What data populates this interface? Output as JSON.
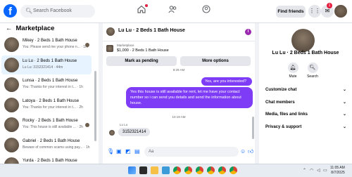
{
  "topbar": {
    "logo": "f",
    "search_placeholder": "Search Facebook",
    "find_friends": "Find friends",
    "notification_count": "1",
    "nav_icons": [
      "home-icon",
      "friends-icon",
      "groups-icon"
    ]
  },
  "sidebar": {
    "title": "Marketplace",
    "back": "←",
    "conversations": [
      {
        "name": "Mikey · 2 Beds 1 Bath House",
        "preview": "You: Please send me your phone n... · 1m",
        "active": false
      },
      {
        "name": "Lu Lu · 2 Beds 1 Bath House",
        "preview": "Lu Lu: 3152321414 · 44m",
        "active": true
      },
      {
        "name": "Lunsa · 2 Beds 1 Bath House",
        "preview": "You: Thanks for your interest in t... · 1h",
        "active": false
      },
      {
        "name": "Latoya · 2 Beds 1 Bath House",
        "preview": "You: Thanks for your interest in t... · 2h",
        "active": false
      },
      {
        "name": "Rocky · 2 Beds 1 Bath House",
        "preview": "You: This house is still available ... · 2h",
        "active": false
      },
      {
        "name": "Gabriel · 2 Beds 1 Bath House",
        "preview": "Beware of common scams using pay... · 1h",
        "active": false
      },
      {
        "name": "Yurda · 2 Beds 1 Bath House",
        "preview": "You: Please can you hear contact num... · 1h",
        "active": false
      }
    ]
  },
  "chat": {
    "title": "Lu Lu · 2 Beds 1 Bath House",
    "info_icon": "i",
    "listing_source": "Marketplace",
    "listing_price": "$1,000 · 2 Beds 1 Bath House",
    "mark_pending": "Mark as pending",
    "more_options": "More options",
    "time1": "9:29 AM",
    "msg_out1": "Yes, are you interested?",
    "msg_out2": "Yes this house is still available for rent, let me have your contact number so i can send you details and send the information about house.",
    "time2": "10:19 AM",
    "sender": "Lu Lu",
    "msg_in": "3152321414",
    "composer_placeholder": "Aa"
  },
  "right_panel": {
    "title": "Lu Lu · 2 Beds 1 Bath House",
    "mute": "Mute",
    "search": "Search",
    "sections": [
      "Customize chat",
      "Chat members",
      "Media, files and links",
      "Privacy & support"
    ]
  },
  "taskbar": {
    "time": "11:05 AM",
    "date": "8/7/2025"
  },
  "colors": {
    "accent": "#0866ff",
    "bubble": "#7f3cf7"
  }
}
